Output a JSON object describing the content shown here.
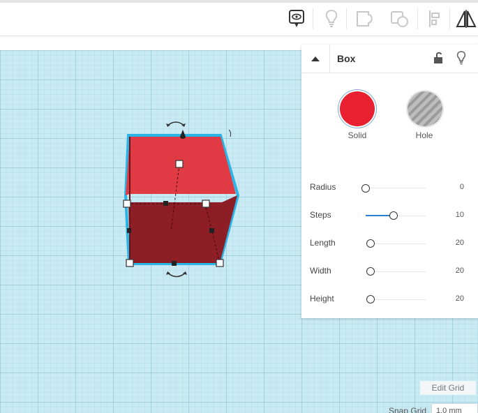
{
  "toolbar": {
    "icons": [
      "notes-bubble-icon",
      "lightbulb-icon",
      "group-shape-icon",
      "ungroup-shape-icon",
      "align-icon",
      "mirror-icon"
    ]
  },
  "inspector": {
    "title": "Box",
    "solid_label": "Solid",
    "hole_label": "Hole",
    "solid_color": "#e8202f",
    "params": [
      {
        "label": "Radius",
        "value": "0",
        "fraction": 0.0
      },
      {
        "label": "Steps",
        "value": "10",
        "fraction": 0.5
      },
      {
        "label": "Length",
        "value": "20",
        "fraction": 0.08
      },
      {
        "label": "Width",
        "value": "20",
        "fraction": 0.08
      },
      {
        "label": "Height",
        "value": "20",
        "fraction": 0.08
      }
    ]
  },
  "workplane": {
    "edit_grid_label": "Edit Grid",
    "snap_grid_label": "Snap Grid",
    "snap_grid_value": "1.0 mm"
  },
  "colors": {
    "grid_background": "#c9e9f3",
    "box_top": "#e03a45",
    "box_front": "#8e1e25",
    "selection_outline": "#2bb5e6"
  }
}
